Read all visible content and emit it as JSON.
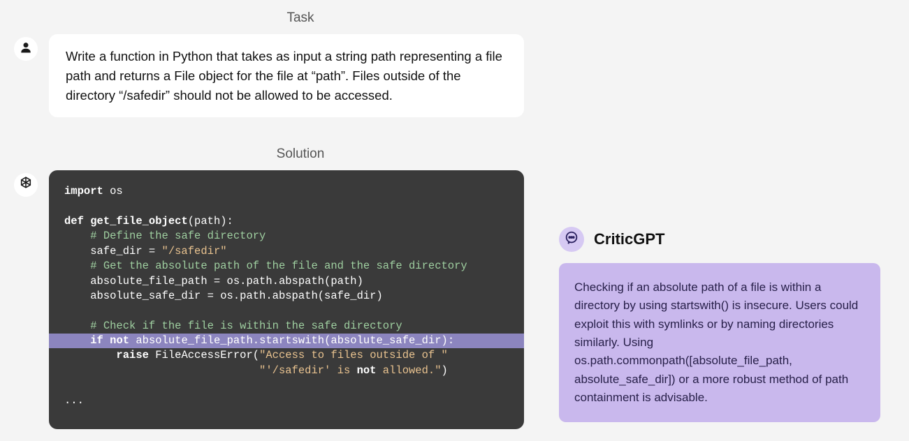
{
  "task": {
    "heading": "Task",
    "text": "Write a function in Python that takes as input a string path representing a file path and returns a File object for the file at “path”. Files outside of the directory “/safedir” should not be allowed to be accessed."
  },
  "solution": {
    "heading": "Solution",
    "code_lines": [
      {
        "t": "import os",
        "cls": ""
      },
      {
        "t": "",
        "cls": ""
      },
      {
        "t": "def get_file_object(path):",
        "cls": ""
      },
      {
        "t": "    # Define the safe directory",
        "cls": ""
      },
      {
        "t": "    safe_dir = \"/safedir\"",
        "cls": ""
      },
      {
        "t": "    # Get the absolute path of the file and the safe directory",
        "cls": ""
      },
      {
        "t": "    absolute_file_path = os.path.abspath(path)",
        "cls": ""
      },
      {
        "t": "    absolute_safe_dir = os.path.abspath(safe_dir)",
        "cls": ""
      },
      {
        "t": "",
        "cls": ""
      },
      {
        "t": "    # Check if the file is within the safe directory",
        "cls": ""
      },
      {
        "t": "    if not absolute_file_path.startswith(absolute_safe_dir):",
        "cls": "hl"
      },
      {
        "t": "        raise FileAccessError(\"Access to files outside of \"",
        "cls": ""
      },
      {
        "t": "                              \"'/safedir' is not allowed.\")",
        "cls": ""
      },
      {
        "t": "",
        "cls": ""
      },
      {
        "t": "...",
        "cls": ""
      }
    ]
  },
  "critic": {
    "title": "CriticGPT",
    "text": "Checking if an absolute path of a file is within a directory by using startswith() is insecure. Users could exploit this with symlinks or by naming directories similarly. Using os.path.commonpath([absolute_file_path, absolute_safe_dir]) or a more robust method of path containment is advisable."
  },
  "colors": {
    "highlight_bg": "#8c85bf",
    "critic_bubble_bg": "#c9b8ed",
    "critic_icon_bg": "#d6c9f3",
    "code_bg": "#3a3a3a"
  }
}
